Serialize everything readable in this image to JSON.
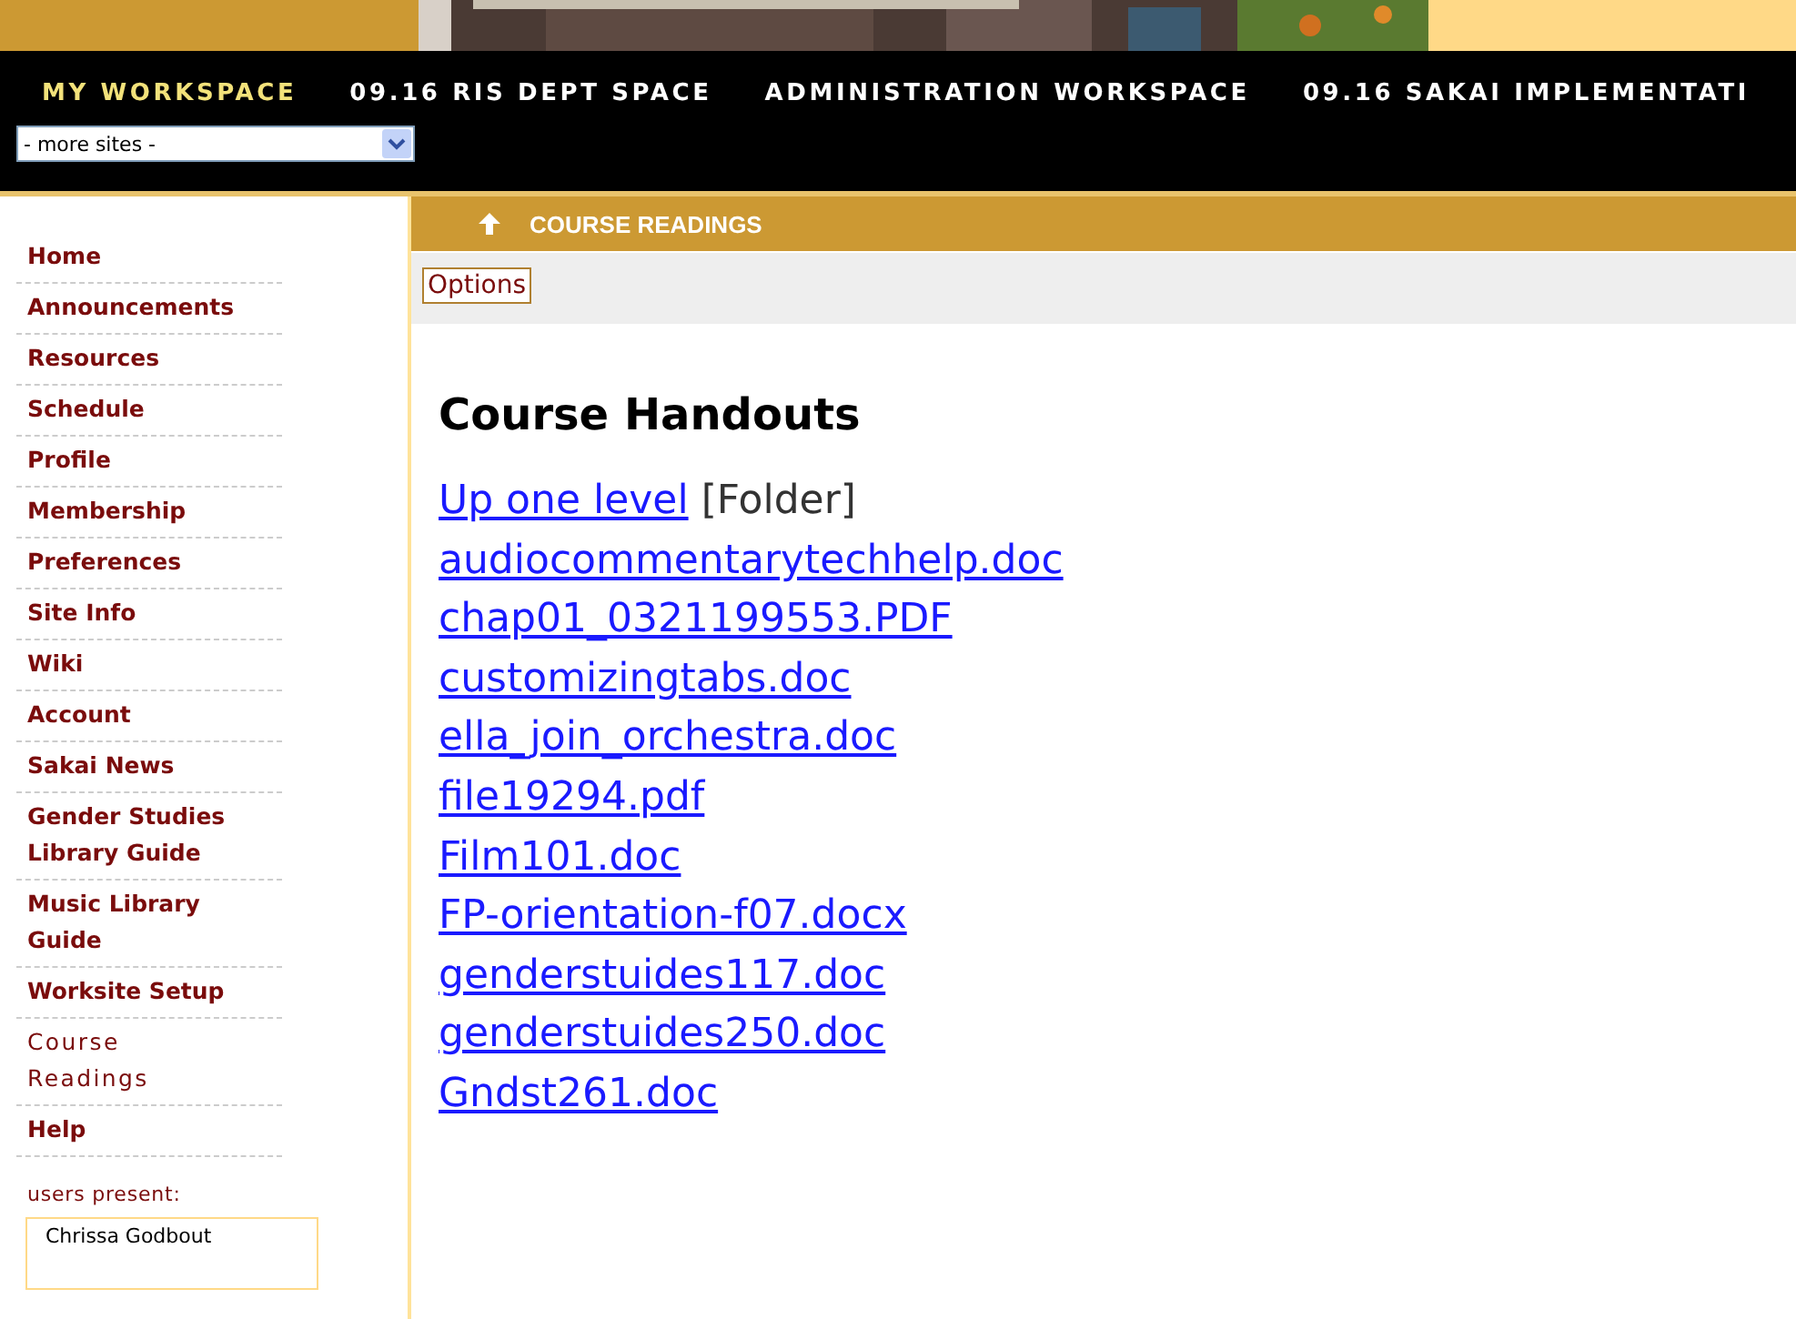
{
  "site_tabs": [
    {
      "label": "MY WORKSPACE",
      "selected": true
    },
    {
      "label": "09.16 RIS DEPT SPACE",
      "selected": false
    },
    {
      "label": "ADMINISTRATION WORKSPACE",
      "selected": false
    },
    {
      "label": "09.16 SAKAI IMPLEMENTATI",
      "selected": false
    }
  ],
  "more_sites": {
    "value": "- more sites -"
  },
  "sidebar": {
    "items": [
      {
        "label": "Home",
        "selected": false
      },
      {
        "label": "Announcements",
        "selected": false
      },
      {
        "label": "Resources",
        "selected": false
      },
      {
        "label": "Schedule",
        "selected": false
      },
      {
        "label": "Profile",
        "selected": false
      },
      {
        "label": "Membership",
        "selected": false
      },
      {
        "label": "Preferences",
        "selected": false
      },
      {
        "label": "Site Info",
        "selected": false
      },
      {
        "label": "Wiki",
        "selected": false
      },
      {
        "label": "Account",
        "selected": false
      },
      {
        "label": "Sakai News",
        "selected": false
      },
      {
        "label": "Gender Studies Library Guide",
        "selected": false
      },
      {
        "label": "Music Library Guide",
        "selected": false
      },
      {
        "label": "Worksite Setup",
        "selected": false
      },
      {
        "label": "Course Readings",
        "selected": true
      },
      {
        "label": "Help",
        "selected": false
      }
    ],
    "users_present_label": "users present:",
    "users_present": [
      "Chrissa Godbout"
    ]
  },
  "tool": {
    "title": "COURSE READINGS",
    "options_button": "Options",
    "heading": "Course Handouts",
    "up_link": "Up one level",
    "up_note": "[Folder]",
    "files": [
      "audiocommentarytechhelp.doc",
      "chap01_0321199553.PDF",
      "customizingtabs.doc",
      "ella_join_orchestra.doc",
      "file19294.pdf",
      "Film101.doc",
      "FP-orientation-f07.docx",
      "genderstuides117.doc",
      "genderstuides250.doc",
      "Gndst261.doc"
    ]
  }
}
